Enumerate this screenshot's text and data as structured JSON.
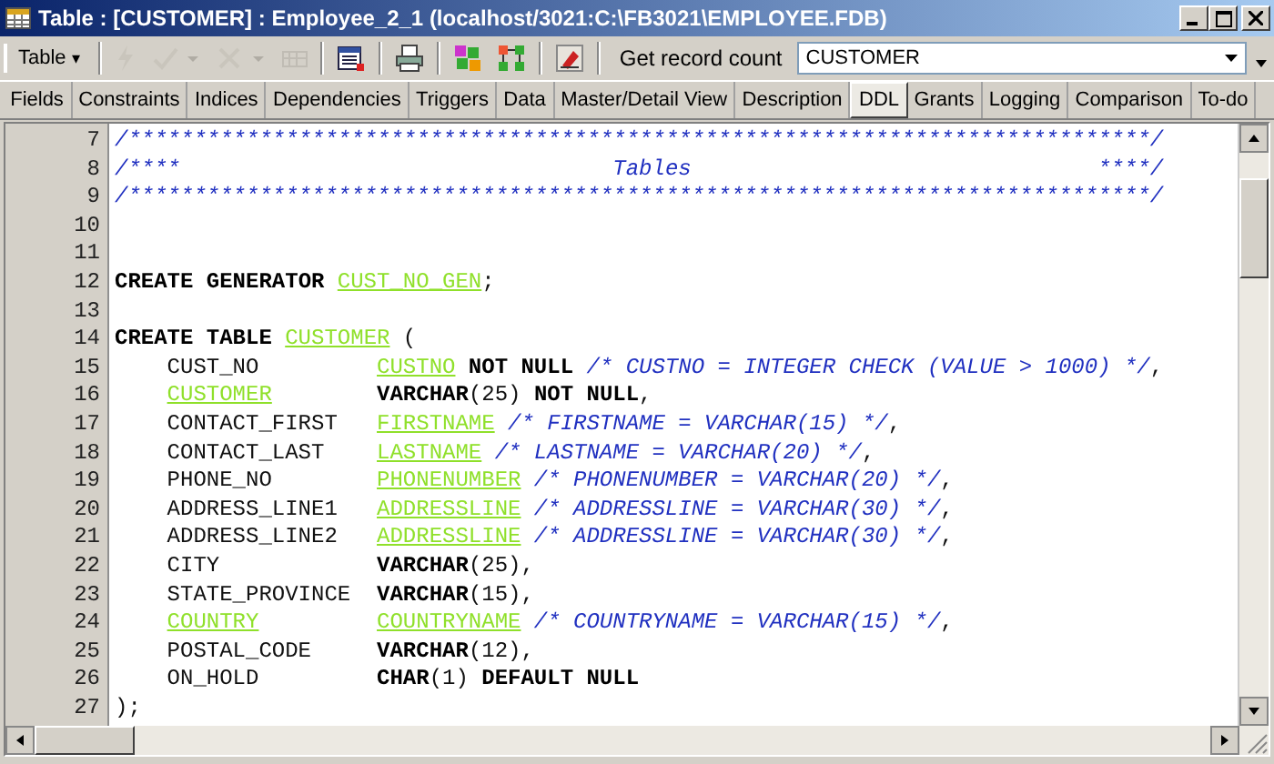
{
  "window": {
    "title": "Table : [CUSTOMER] : Employee_2_1 (localhost/3021:C:\\FB3021\\EMPLOYEE.FDB)"
  },
  "toolbar": {
    "menu": "Table",
    "menu_caret": "▾",
    "icon_buttons": [
      {
        "disabled": true
      },
      {
        "disabled": true
      },
      {
        "disabled": true
      },
      {
        "disabled": true
      }
    ],
    "record_count_button": "Get record count",
    "object_combo": "CUSTOMER"
  },
  "tabs": [
    {
      "label": "Fields",
      "selected": false
    },
    {
      "label": "Constraints",
      "selected": false
    },
    {
      "label": "Indices",
      "selected": false
    },
    {
      "label": "Dependencies",
      "selected": false
    },
    {
      "label": "Triggers",
      "selected": false
    },
    {
      "label": "Data",
      "selected": false
    },
    {
      "label": "Master/Detail View",
      "selected": false
    },
    {
      "label": "Description",
      "selected": false
    },
    {
      "label": "DDL",
      "selected": true
    },
    {
      "label": "Grants",
      "selected": false
    },
    {
      "label": "Logging",
      "selected": false
    },
    {
      "label": "Comparison",
      "selected": false
    },
    {
      "label": "To-do",
      "selected": false
    }
  ],
  "editor": {
    "lines": [
      {
        "number": "7",
        "tokens": [
          {
            "kind": "comment",
            "text": "/******************************************************************************/"
          }
        ]
      },
      {
        "number": "8",
        "tokens": [
          {
            "kind": "comment",
            "text": "/****                                 Tables                               ****/"
          }
        ]
      },
      {
        "number": "9",
        "tokens": [
          {
            "kind": "comment",
            "text": "/******************************************************************************/"
          }
        ]
      },
      {
        "number": "10"
      },
      {
        "number": "11"
      },
      {
        "number": "12",
        "tokens": [
          {
            "kind": "keyword",
            "text": "CREATE GENERATOR"
          },
          {
            "kind": "domain",
            "text": "CUST_NO_GEN"
          },
          {
            "kind": "punct",
            "text": ";"
          }
        ]
      },
      {
        "number": "13"
      },
      {
        "number": "14",
        "tokens": [
          {
            "kind": "keyword",
            "text": "CREATE TABLE"
          },
          {
            "kind": "domain",
            "text": "CUSTOMER"
          },
          {
            "kind": "plain",
            "text": "("
          }
        ]
      },
      {
        "number": "15",
        "column": {
          "kind": "plain",
          "text": "CUST_NO"
        },
        "tokens": [
          {
            "kind": "domain",
            "text": "CUSTNO"
          },
          {
            "kind": "keyword",
            "text": "NOT NULL"
          },
          {
            "kind": "comment",
            "text": "/* CUSTNO = INTEGER CHECK (VALUE > 1000) */"
          },
          {
            "kind": "punct",
            "text": ","
          }
        ]
      },
      {
        "number": "16",
        "column": {
          "kind": "domain",
          "text": "CUSTOMER"
        },
        "tokens": [
          {
            "kind": "keyword",
            "text": "VARCHAR"
          },
          {
            "kind": "punct",
            "text": "(25)"
          },
          {
            "kind": "keyword",
            "text": "NOT NULL"
          },
          {
            "kind": "punct",
            "text": ","
          }
        ]
      },
      {
        "number": "17",
        "column": {
          "kind": "plain",
          "text": "CONTACT_FIRST"
        },
        "tokens": [
          {
            "kind": "domain",
            "text": "FIRSTNAME"
          },
          {
            "kind": "comment",
            "text": "/* FIRSTNAME = VARCHAR(15) */"
          },
          {
            "kind": "punct",
            "text": ","
          }
        ]
      },
      {
        "number": "18",
        "column": {
          "kind": "plain",
          "text": "CONTACT_LAST"
        },
        "tokens": [
          {
            "kind": "domain",
            "text": "LASTNAME"
          },
          {
            "kind": "comment",
            "text": "/* LASTNAME = VARCHAR(20) */"
          },
          {
            "kind": "punct",
            "text": ","
          }
        ]
      },
      {
        "number": "19",
        "column": {
          "kind": "plain",
          "text": "PHONE_NO"
        },
        "tokens": [
          {
            "kind": "domain",
            "text": "PHONENUMBER"
          },
          {
            "kind": "comment",
            "text": "/* PHONENUMBER = VARCHAR(20) */"
          },
          {
            "kind": "punct",
            "text": ","
          }
        ]
      },
      {
        "number": "20",
        "column": {
          "kind": "plain",
          "text": "ADDRESS_LINE1"
        },
        "tokens": [
          {
            "kind": "domain",
            "text": "ADDRESSLINE"
          },
          {
            "kind": "comment",
            "text": "/* ADDRESSLINE = VARCHAR(30) */"
          },
          {
            "kind": "punct",
            "text": ","
          }
        ]
      },
      {
        "number": "21",
        "column": {
          "kind": "plain",
          "text": "ADDRESS_LINE2"
        },
        "tokens": [
          {
            "kind": "domain",
            "text": "ADDRESSLINE"
          },
          {
            "kind": "comment",
            "text": "/* ADDRESSLINE = VARCHAR(30) */"
          },
          {
            "kind": "punct",
            "text": ","
          }
        ]
      },
      {
        "number": "22",
        "column": {
          "kind": "plain",
          "text": "CITY"
        },
        "tokens": [
          {
            "kind": "keyword",
            "text": "VARCHAR"
          },
          {
            "kind": "punct",
            "text": "(25),"
          }
        ]
      },
      {
        "number": "23",
        "column": {
          "kind": "plain",
          "text": "STATE_PROVINCE"
        },
        "tokens": [
          {
            "kind": "keyword",
            "text": "VARCHAR"
          },
          {
            "kind": "punct",
            "text": "(15),"
          }
        ]
      },
      {
        "number": "24",
        "column": {
          "kind": "domain",
          "text": "COUNTRY"
        },
        "tokens": [
          {
            "kind": "domain",
            "text": "COUNTRYNAME"
          },
          {
            "kind": "comment",
            "text": "/* COUNTRYNAME = VARCHAR(15) */"
          },
          {
            "kind": "punct",
            "text": ","
          }
        ]
      },
      {
        "number": "25",
        "column": {
          "kind": "plain",
          "text": "POSTAL_CODE"
        },
        "tokens": [
          {
            "kind": "keyword",
            "text": "VARCHAR"
          },
          {
            "kind": "punct",
            "text": "(12),"
          }
        ]
      },
      {
        "number": "26",
        "column": {
          "kind": "plain",
          "text": "ON_HOLD"
        },
        "tokens": [
          {
            "kind": "keyword",
            "text": "CHAR"
          },
          {
            "kind": "punct",
            "text": "(1)"
          },
          {
            "kind": "keyword",
            "text": "DEFAULT NULL"
          }
        ]
      },
      {
        "number": "27",
        "tokens": [
          {
            "kind": "punct",
            "text": ");"
          }
        ]
      }
    ]
  }
}
